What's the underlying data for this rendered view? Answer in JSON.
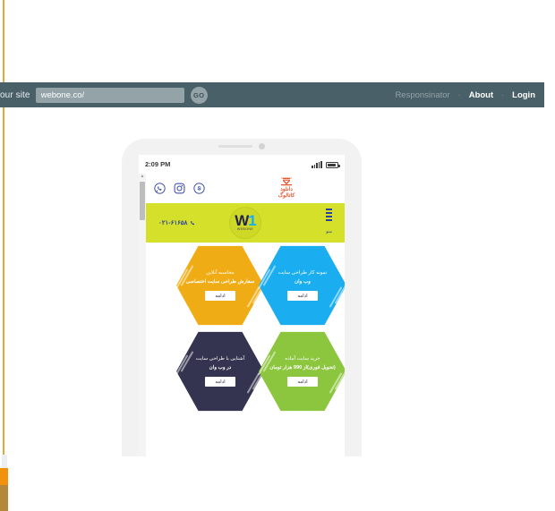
{
  "toolbar": {
    "prefix_label": "our site",
    "url_value": "webone.co/",
    "url_placeholder": "webone.co/",
    "go_label": "GO",
    "links": [
      {
        "label": "Responsinator",
        "muted": true
      },
      {
        "label": "About",
        "muted": false
      },
      {
        "label": "Login",
        "muted": false
      }
    ],
    "separator": "·",
    "background": "#4a6068",
    "field_background": "#93a3a8"
  },
  "phone": {
    "status_bar": {
      "time": "2:09 PM",
      "signal_icon": "signal-bars-icon",
      "battery_icon": "battery-icon"
    },
    "scrollbar": {
      "up_arrow": "▲"
    }
  },
  "site": {
    "social": [
      {
        "name": "whatsapp-icon",
        "glyph": "whatsapp"
      },
      {
        "name": "instagram-icon",
        "glyph": "instagram"
      },
      {
        "name": "skype-icon",
        "glyph": "skype"
      }
    ],
    "catalog": {
      "line1": "دانلود",
      "line2": "کاتالوگ",
      "color": "#e8542f"
    },
    "header": {
      "phone_number": "۰۲۱-۶۱۶۵۸",
      "phone_icon": "phone-icon",
      "logo_mark": "W",
      "logo_accent": "1",
      "logo_text": "WEBONE",
      "menu_label": "منو",
      "menu_icon": "hamburger-icon",
      "background": "#d4e02a"
    },
    "cards": [
      {
        "id": "custom-design-order",
        "line1": "محاسبه آنلاین",
        "line2": "سفارش طراحی سایت اختصاصی",
        "button": "ادامه",
        "bg": "#f0ac15",
        "fg": "#ffffff"
      },
      {
        "id": "portfolio",
        "line1": "نمونه کار طراحی سایت",
        "line2": "وب وان",
        "button": "ادامه",
        "bg": "#1aaef0",
        "fg": "#ffffff"
      },
      {
        "id": "about-design",
        "line1": "آشنایی با طراحی سایت",
        "line2": "در وب وان",
        "button": "ادامه",
        "bg": "#343450",
        "fg": "#ffffff"
      },
      {
        "id": "ready-site-purchase",
        "line1": "خرید سایت آماده",
        "line2": "(تحویل فوری)از 990 هزار تومان",
        "button": "ادامه",
        "bg": "#8cc63e",
        "fg": "#ffffff"
      }
    ]
  }
}
